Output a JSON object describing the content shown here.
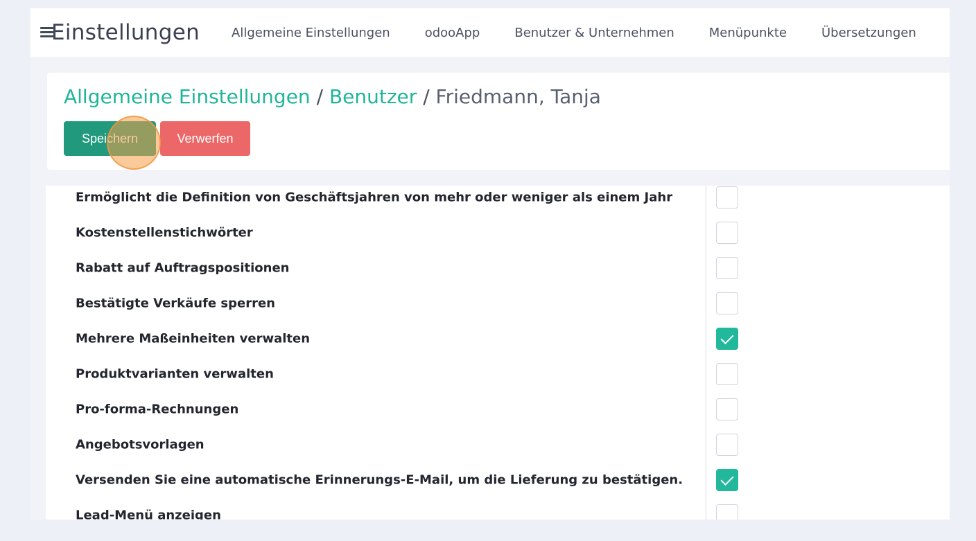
{
  "header": {
    "app_title": "Einstellungen",
    "menu": [
      "Allgemeine Einstellungen",
      "odooApp",
      "Benutzer & Unternehmen",
      "Menüpunkte",
      "Übersetzungen"
    ]
  },
  "breadcrumb": {
    "items": [
      "Allgemeine Einstellungen",
      "Benutzer"
    ],
    "separator": "/",
    "current": "Friedmann, Tanja"
  },
  "actions": {
    "save_label": "Speichern",
    "discard_label": "Verwerfen"
  },
  "settings": [
    {
      "label": "Ermöglicht die Definition von Geschäftsjahren von mehr oder weniger als einem Jahr",
      "checked": false
    },
    {
      "label": "Kostenstellenstichwörter",
      "checked": false
    },
    {
      "label": "Rabatt auf Auftragspositionen",
      "checked": false
    },
    {
      "label": "Bestätigte Verkäufe sperren",
      "checked": false
    },
    {
      "label": "Mehrere Maßeinheiten verwalten",
      "checked": true
    },
    {
      "label": "Produktvarianten verwalten",
      "checked": false
    },
    {
      "label": "Pro-forma-Rechnungen",
      "checked": false
    },
    {
      "label": "Angebotsvorlagen",
      "checked": false
    },
    {
      "label": "Versenden Sie eine automatische Erinnerungs-E-Mail, um die Lieferung zu bestätigen.",
      "checked": true
    },
    {
      "label": "Lead-Menü anzeigen",
      "checked": false
    }
  ],
  "colors": {
    "accent": "#1fb59a",
    "save": "#21997c",
    "discard": "#ec6767",
    "click_marker": "#f69e48"
  },
  "icons": {
    "menu": "hamburger-icon",
    "check": "checkmark-icon"
  }
}
